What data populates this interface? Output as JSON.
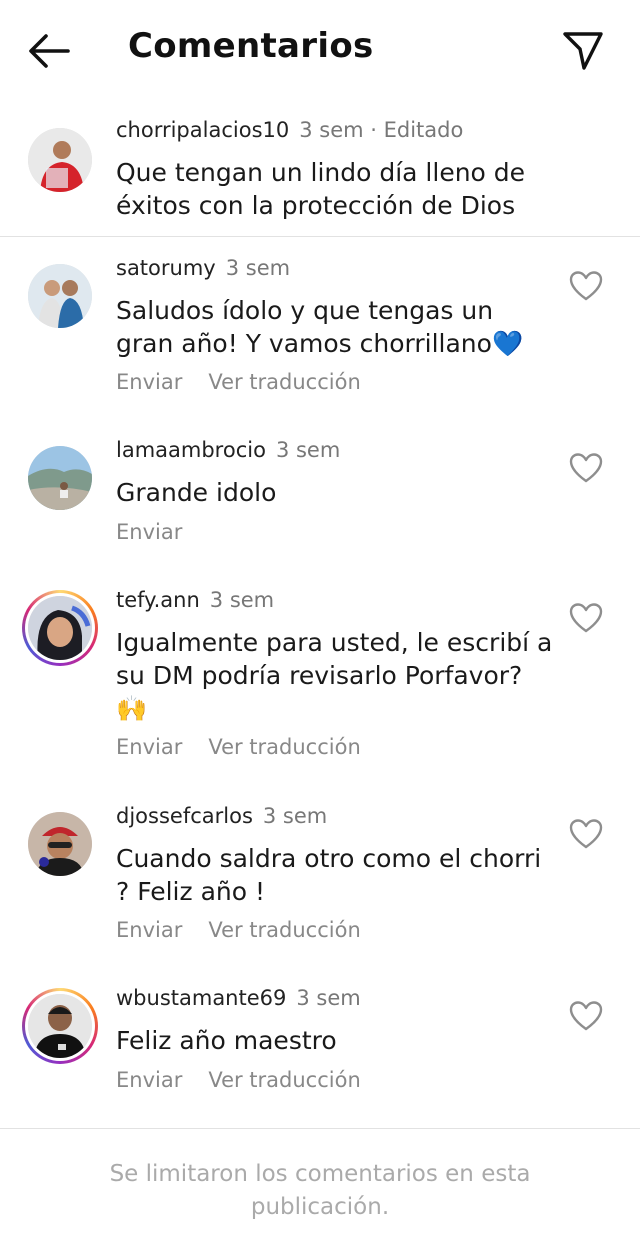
{
  "header": {
    "title": "Comentarios",
    "back_icon": "arrow-left-icon",
    "share_icon": "paper-plane-icon"
  },
  "caption": {
    "username": "chorripalacios10",
    "time": "3 sem · Editado",
    "text": "Que tengan un lindo día lleno de éxitos con la protección de Dios"
  },
  "comments": [
    {
      "username": "satorumy",
      "time": "3 sem",
      "text": "Saludos ídolo y que tengas un gran año! Y vamos chorrillano💙",
      "reply_label": "Enviar",
      "translate_label": "Ver traducción"
    },
    {
      "username": "lamaambrocio",
      "time": "3 sem",
      "text": "Grande  idolo",
      "reply_label": "Enviar"
    },
    {
      "username": "tefy.ann",
      "time": "3 sem",
      "text": "Igualmente para usted, le escribí a su DM podría revisarlo Porfavor? 🙌",
      "reply_label": "Enviar",
      "translate_label": "Ver traducción"
    },
    {
      "username": "djossefcarlos",
      "time": "3 sem",
      "text": "Cuando saldra otro como el chorri ? Feliz año !",
      "reply_label": "Enviar",
      "translate_label": "Ver traducción"
    },
    {
      "username": "wbustamante69",
      "time": "3 sem",
      "text": "Feliz año  maestro",
      "reply_label": "Enviar",
      "translate_label": "Ver traducción"
    }
  ],
  "footer": {
    "note": "Se limitaron los comentarios en esta publicación."
  },
  "colors": {
    "text": "#111111",
    "muted": "#888888",
    "divider": "#e2e2e2",
    "story_ring": [
      "#feda75",
      "#fa7e1e",
      "#d62976",
      "#962fbf",
      "#4f5bd5"
    ]
  }
}
